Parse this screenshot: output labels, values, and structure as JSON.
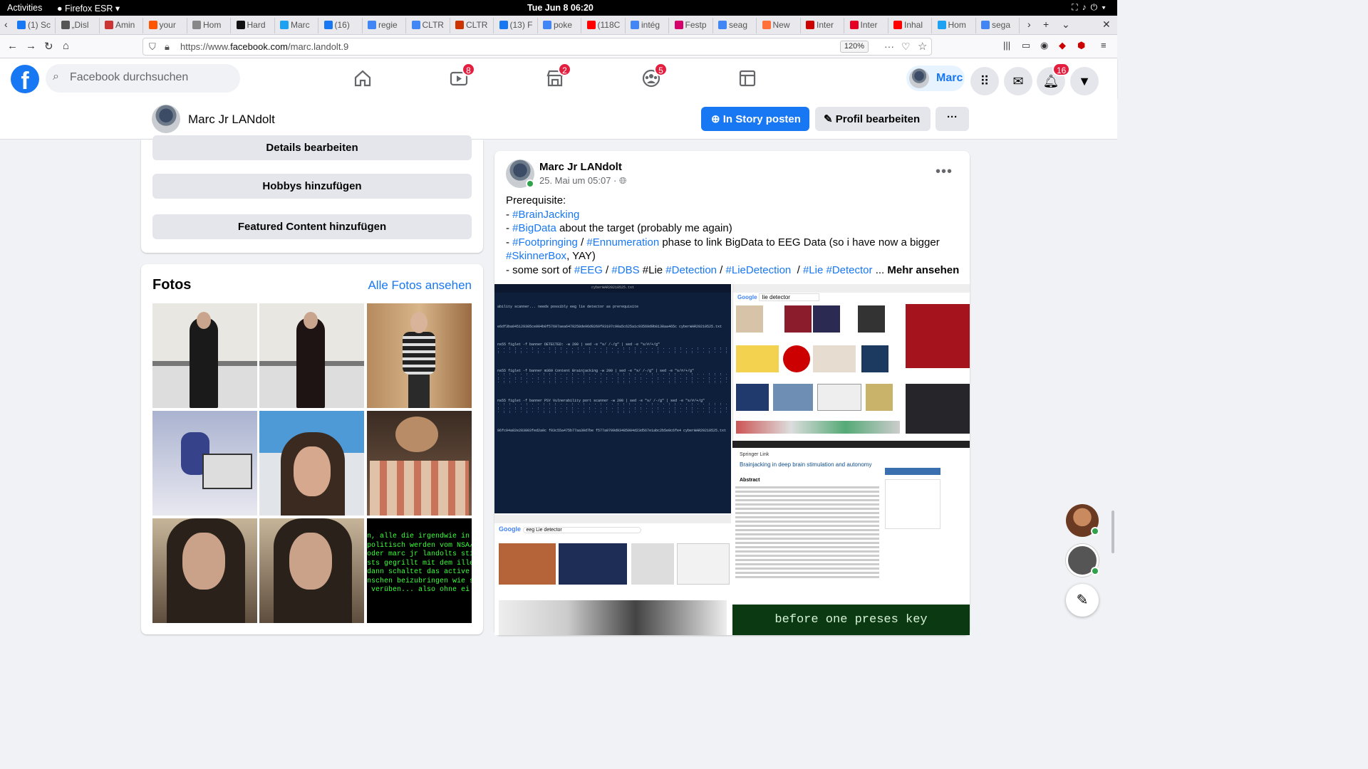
{
  "system": {
    "activities": "Activities",
    "app_name": "Firefox ESR",
    "clock": "Tue Jun 8  06:20"
  },
  "tabs": [
    {
      "label": "(1) Sc",
      "color": "#1877f2"
    },
    {
      "label": "„Disl",
      "color": "#555555"
    },
    {
      "label": "Amin",
      "color": "#cc3333"
    },
    {
      "label": "your",
      "color": "#ff5500"
    },
    {
      "label": "Hom",
      "color": "#888888"
    },
    {
      "label": "Hard",
      "color": "#111111"
    },
    {
      "label": "Marc",
      "color": "#1da1f2"
    },
    {
      "label": "(16)",
      "color": "#1877f2"
    },
    {
      "label": "regie",
      "color": "#4285f4"
    },
    {
      "label": "CLTR",
      "color": "#4285f4"
    },
    {
      "label": "CLTR",
      "color": "#cc3300"
    },
    {
      "label": "(13) F",
      "color": "#1877f2"
    },
    {
      "label": "poke",
      "color": "#4285f4"
    },
    {
      "label": "(118C",
      "color": "#ff0000"
    },
    {
      "label": "intég",
      "color": "#4285f4"
    },
    {
      "label": "Festp",
      "color": "#d6006c"
    },
    {
      "label": "seag",
      "color": "#4285f4"
    },
    {
      "label": "New",
      "color": "#ff7139"
    },
    {
      "label": "Inter",
      "color": "#cc0000"
    },
    {
      "label": "Inter",
      "color": "#e60023"
    },
    {
      "label": "Inhal",
      "color": "#ff0000"
    },
    {
      "label": "Hom",
      "color": "#1da1f2"
    },
    {
      "label": "sega",
      "color": "#4285f4"
    }
  ],
  "browser": {
    "url_prefix": "https://www.",
    "url_host": "facebook.com",
    "url_path": "/marc.landolt.9",
    "zoom": "120%"
  },
  "fb": {
    "search_placeholder": "Facebook durchsuchen",
    "badges": {
      "watch": "8",
      "marketplace": "2",
      "groups": "5",
      "notifications": "16"
    },
    "user_short": "Marc",
    "accent": "#1877f2"
  },
  "profile": {
    "name": "Marc Jr LANdolt",
    "story_button": "In Story posten",
    "edit_button": "Profil bearbeiten",
    "more_button": "···"
  },
  "intro": {
    "details": "Details bearbeiten",
    "hobbies": "Hobbys hinzufügen",
    "featured": "Featured Content hinzufügen"
  },
  "photos": {
    "title": "Fotos",
    "see_all": "Alle Fotos ansehen",
    "terminal_text": "n, alle die irgendwie in z\npolitisch werden vom NSA/C\noder marc jr landolts sti\nsts gegrillt mit dem illeg\ndann schaltet das active\nnschen beizubringen wie s\n verüben... also ohne ei"
  },
  "post": {
    "author": "Marc Jr LANdolt",
    "date": "25. Mai um 05:07 ·",
    "line1": "Prerequisite:",
    "dash": "- ",
    "brainjacking": "#BrainJacking",
    "bigdata": "#BigData",
    "bigdata_rest": " about the target (probably me again)",
    "footprinting": "#Footpringing",
    "slash": " / ",
    "enumeration": "#Ennumeration",
    "enum_rest": " phase to link BigData to EEG Data (so i have now a bigger",
    "skinnerbox": "#SkinnerBox",
    "yay": ", YAY)",
    "some_sort": "- some sort of ",
    "eeg": "#EEG",
    "dbs": "#DBS",
    "lie_plain": " #Lie ",
    "detection": "#Detection",
    "liedetection": "#LieDetection",
    "lie": "#Lie",
    "detector": "#Detector",
    "ellipsis": " ... ",
    "more": "Mehr ansehen"
  },
  "post_images": {
    "terminal_title": "cyberWAR20210525.txt",
    "terminal_lines": [
      "ability scanner... needs possibly eeg lie detector as prerequisite",
      "e6df3ba045129305ce004b0f57607aea6478258de96d9269f93197c90a5c625a1c93569d9b8138aa465c  cyberWAR20210525.txt",
      "ns55 figlet -f banner DETECTED: -w 200 | sed -e \"s/ /-/g\" | sed -e \"s/#/+/g\"",
      "ns55 figlet -f banner m369 Content Brainjacking -w 200 | sed -e \"s/ /-/g\" | sed -e \"s/#/+/g\"",
      "ns55 figlet -f banner PSY Vulnerability port scanner -w 200 | sed -e \"s/ /-/g\" | sed -e \"s/#/+/g\"",
      "96fc04a02e283803fed2a0c f03c55a475b77aa30d7be f577a0709d93485004d23d567e1abc2b5e0c6fe4  cyberWAR20210525.txt"
    ],
    "google_query1": "lie detector",
    "paper_brand": "Springer Link",
    "paper_title": "Brainjacking in deep brain stimulation and autonomy",
    "paper_abstract_label": "Abstract",
    "google_query2": "eeg Lie detector",
    "green_text": "before one preses key"
  }
}
